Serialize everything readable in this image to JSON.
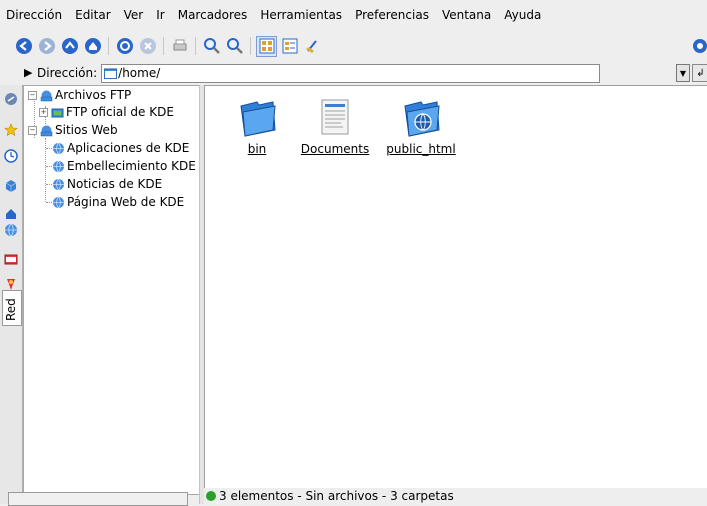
{
  "menu": [
    {
      "label": "Dirección"
    },
    {
      "label": "Editar"
    },
    {
      "label": "Ver"
    },
    {
      "label": "Ir"
    },
    {
      "label": "Marcadores"
    },
    {
      "label": "Herramientas"
    },
    {
      "label": "Preferencias"
    },
    {
      "label": "Ventana"
    },
    {
      "label": "Ayuda"
    }
  ],
  "location": {
    "label": "Dirección:",
    "value": "/home/"
  },
  "tree": {
    "ftp": {
      "label": "Archivos FTP",
      "children": [
        {
          "label": "FTP oficial de KDE"
        }
      ]
    },
    "web": {
      "label": "Sitios Web",
      "children": [
        {
          "label": "Aplicaciones de KDE"
        },
        {
          "label": "Embellecimiento KDE"
        },
        {
          "label": "Noticias de KDE"
        },
        {
          "label": "Página Web de KDE"
        }
      ]
    }
  },
  "sidebar": {
    "active_tab": "Red"
  },
  "files": [
    {
      "name": "bin",
      "icon": "folder-icon"
    },
    {
      "name": "Documents",
      "icon": "document-icon"
    },
    {
      "name": "public_html",
      "icon": "web-folder-icon"
    }
  ],
  "status": {
    "text": "3 elementos - Sin archivos - 3 carpetas"
  },
  "colors": {
    "accent": "#2a66c9",
    "folder": "#3a8fe0",
    "status_ok": "#2aa02a"
  }
}
